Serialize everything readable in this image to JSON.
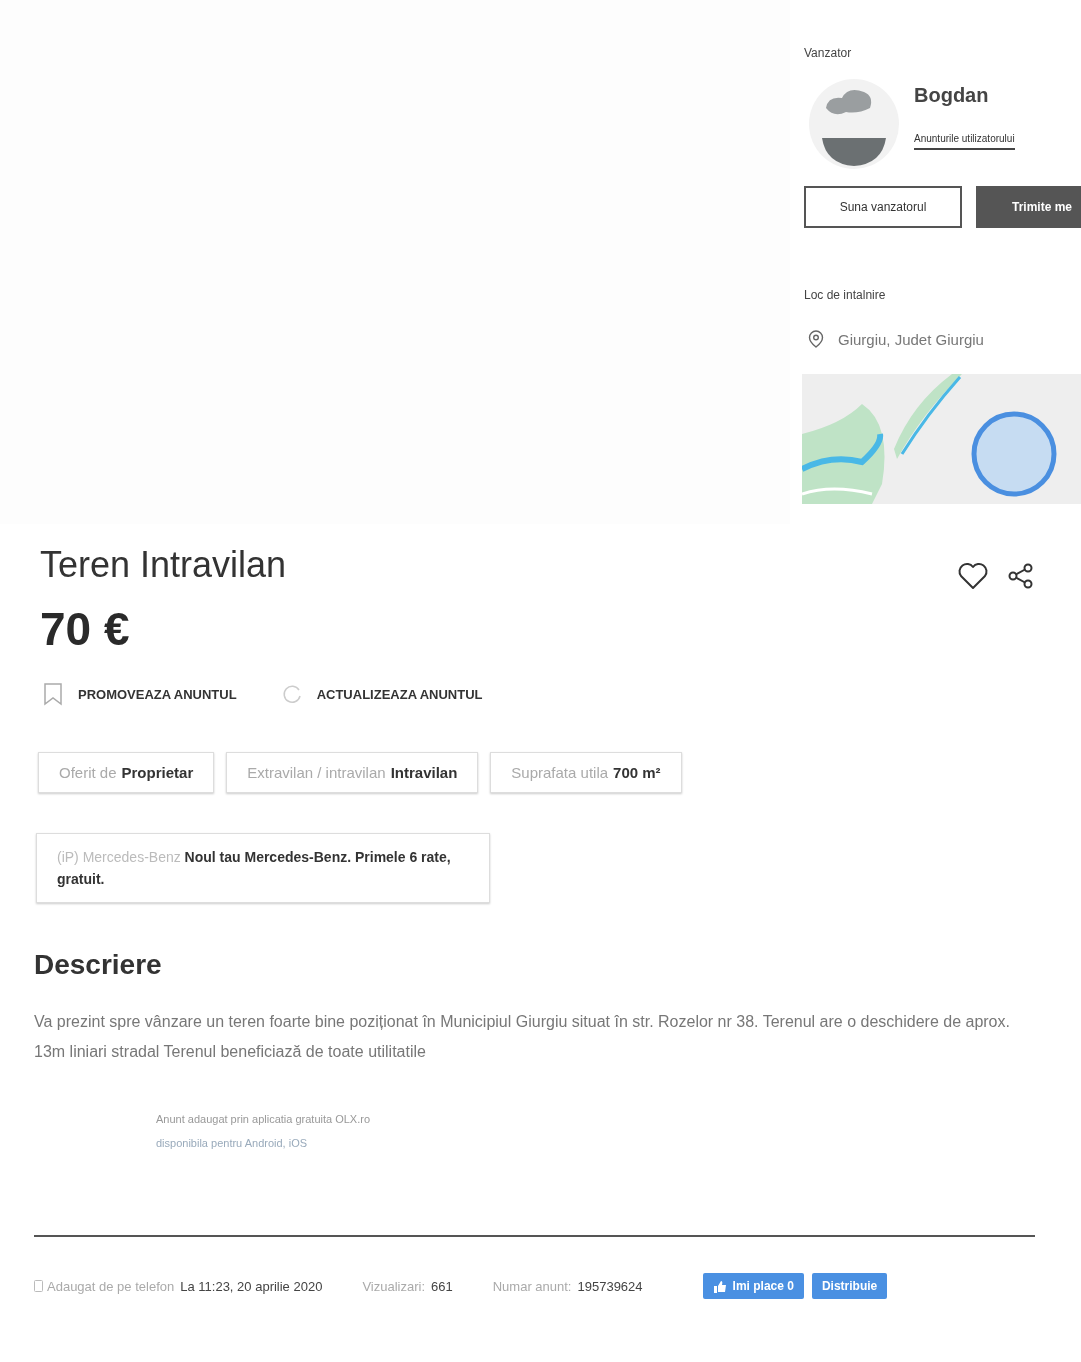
{
  "seller": {
    "heading": "Vanzator",
    "name": "Bogdan",
    "ads_link": "Anunturile utilizatorului",
    "buttons": [
      {
        "label": "Suna vanzatorul",
        "kind": "outline"
      },
      {
        "label": "Trimite me",
        "kind": "filled"
      }
    ]
  },
  "location": {
    "heading": "Loc de intalnire",
    "place": "Giurgiu, Judet Giurgiu"
  },
  "listing": {
    "title": "Teren Intravilan",
    "price": "70 €",
    "actions": [
      {
        "label": "PROMOVEAZA ANUNTUL",
        "kind": "bookmark"
      },
      {
        "label": "ACTUALIZEAZA ANUNTUL",
        "kind": "refresh"
      }
    ],
    "attributes": [
      {
        "label": "Oferit de",
        "value": "Proprietar"
      },
      {
        "label": "Extravilan / intravilan",
        "value": "Intravilan"
      },
      {
        "label": "Suprafata utila",
        "value": "700 m²"
      }
    ],
    "ad": {
      "sponsor": "(iP) Mercedes-Benz",
      "text": "Noul tau Mercedes-Benz. Primele 6 rate, gratuit."
    },
    "description_heading": "Descriere",
    "description": "Va prezint spre vânzare un teren foarte bine poziționat în Municipiul Giurgiu situat în str. Rozelor nr 38. Terenul are o deschidere de aprox. 13m liniari stradal Terenul beneficiază de toate utilitatile",
    "app_note": [
      "Anunt adaugat prin aplicatia gratuita OLX.ro",
      "disponibila pentru Android, iOS"
    ]
  },
  "footer": {
    "added_label": "Adaugat de pe telefon",
    "added_value": "La 11:23, 20 aprilie 2020",
    "views_label": "Vizualizari:",
    "views_value": "661",
    "id_label": "Numar anunt:",
    "id_value": "195739624",
    "buttons": [
      "Imi place 0",
      "Distribuie"
    ]
  }
}
